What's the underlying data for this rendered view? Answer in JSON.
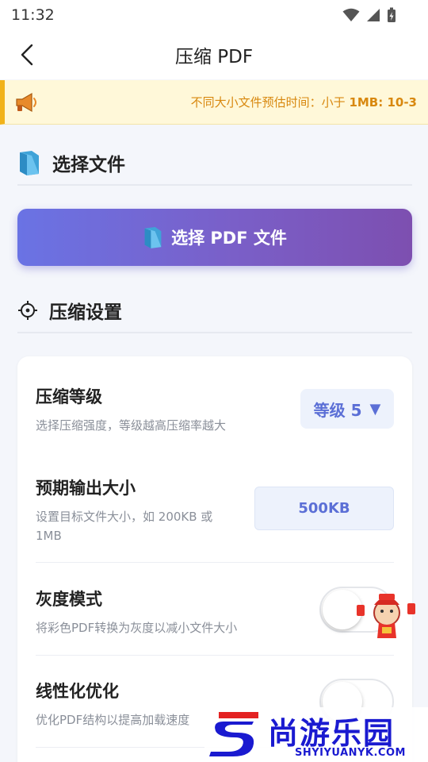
{
  "status_bar": {
    "time": "11:32",
    "icons": [
      "wifi-icon",
      "signal-icon",
      "battery-charging-icon"
    ]
  },
  "app_bar": {
    "back_icon": "chevron-left-icon",
    "title": "压缩 PDF"
  },
  "notice": {
    "icon": "megaphone-icon",
    "text_prefix": "不同大小文件预估时间：小于 ",
    "text_bold": "1MB: 10-3"
  },
  "select_section": {
    "icon": "folder-icon",
    "title": "选择文件",
    "button_icon": "folder-icon",
    "button_label": "选择 PDF 文件"
  },
  "settings_section": {
    "icon": "gear-icon",
    "title": "压缩设置"
  },
  "settings": {
    "level": {
      "title": "压缩等级",
      "desc": "选择压缩强度，等级越高压缩率越大",
      "value": "等级 5",
      "arrow": "▼"
    },
    "target_size": {
      "title": "预期输出大小",
      "desc": "设置目标文件大小，如 200KB 或 1MB",
      "value": "500KB"
    },
    "grayscale": {
      "title": "灰度模式",
      "desc": "将彩色PDF转换为灰度以减小文件大小",
      "enabled": false
    },
    "linearize": {
      "title": "线性化优化",
      "desc": "优化PDF结构以提高加载速度",
      "enabled": false
    }
  },
  "watermark": {
    "brand_cn": "尚游乐园",
    "brand_en": "SHYIYUANYK.COM"
  },
  "colors": {
    "accent": "#5b6fd6",
    "button_gradient_start": "#6a73e4",
    "button_gradient_end": "#7d4fb0",
    "notice_text": "#d8880f",
    "notice_bar": "#f1b21a",
    "folder": "#5ab4e6",
    "watermark": "#1a1ad0"
  }
}
